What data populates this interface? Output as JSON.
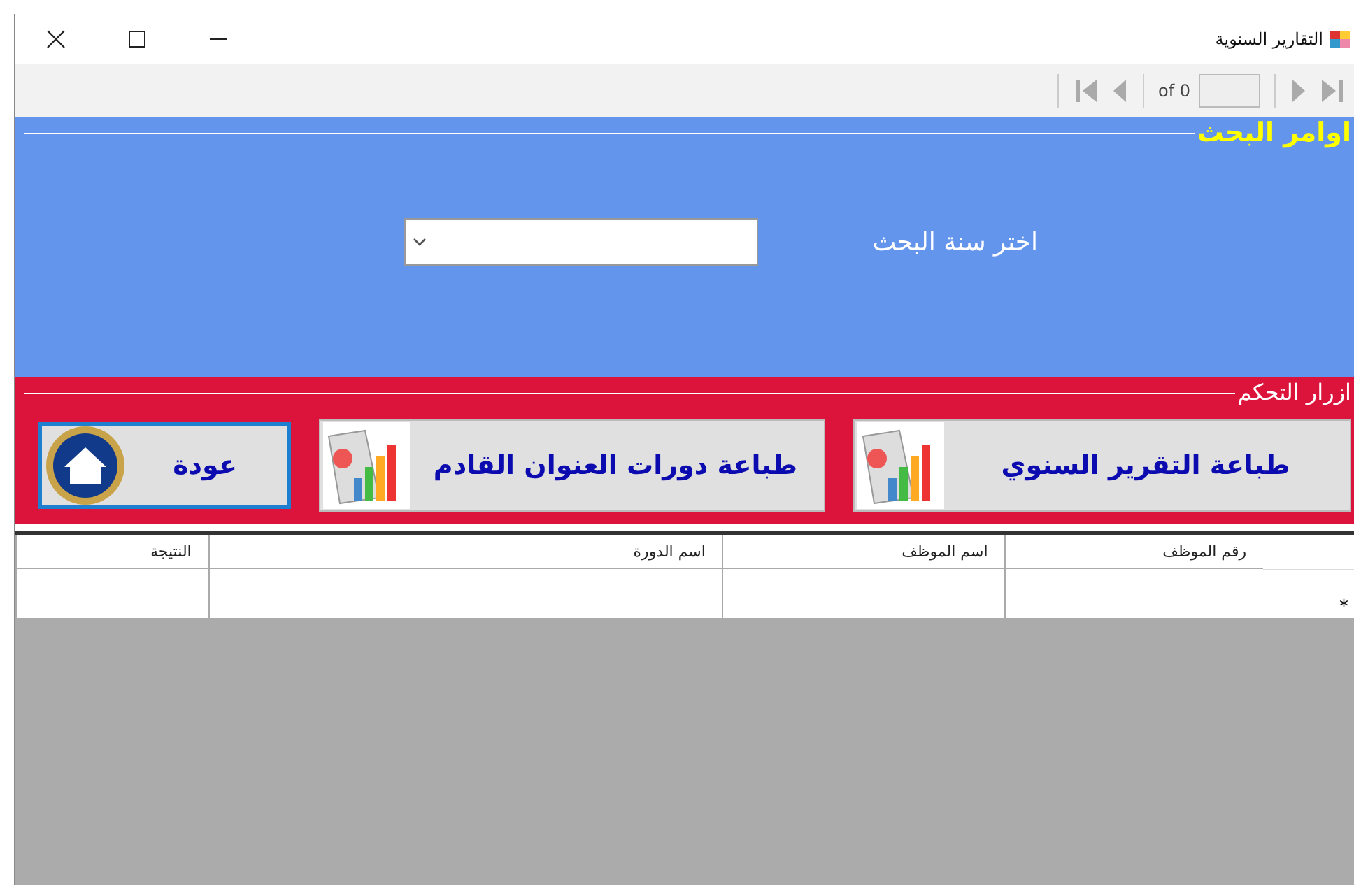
{
  "window": {
    "title": "التقارير السنوية"
  },
  "toolbar": {
    "page_count": "of 0"
  },
  "search": {
    "legend": "اوامر البحث",
    "label": "اختر سنة البحث"
  },
  "controls": {
    "legend": "ازرار التحكم",
    "buttons": [
      {
        "label": "طباعة التقرير السنوي",
        "kind": "chart",
        "focused": false
      },
      {
        "label": "طباعة دورات العنوان القادم",
        "kind": "chart",
        "focused": false
      },
      {
        "label": "عودة",
        "kind": "home",
        "focused": true
      }
    ]
  },
  "table": {
    "columns": [
      "رقم الموظف",
      "اسم الموظف",
      "اسم الدورة",
      "النتيجة"
    ],
    "new_row_marker": "*"
  }
}
